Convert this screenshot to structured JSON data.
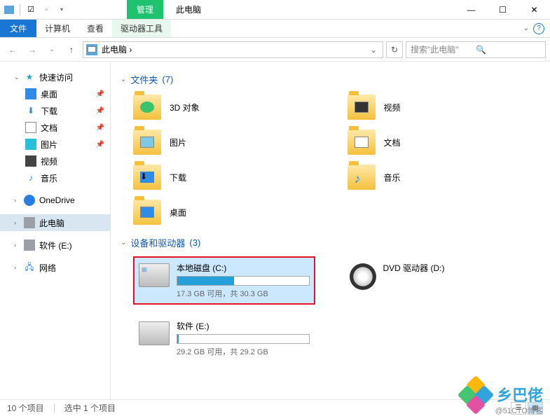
{
  "titlebar": {
    "context_tab": "管理",
    "title": "此电脑"
  },
  "ribbon": {
    "file": "文件",
    "tabs": [
      "计算机",
      "查看"
    ],
    "context_tab": "驱动器工具"
  },
  "address": {
    "path": "此电脑 ›",
    "search_placeholder": "搜索\"此电脑\""
  },
  "sidebar": {
    "quick_access": "快速访问",
    "items": [
      {
        "label": "桌面",
        "pinned": true
      },
      {
        "label": "下载",
        "pinned": true
      },
      {
        "label": "文档",
        "pinned": true
      },
      {
        "label": "图片",
        "pinned": true
      },
      {
        "label": "视频",
        "pinned": false
      },
      {
        "label": "音乐",
        "pinned": false
      }
    ],
    "onedrive": "OneDrive",
    "this_pc": "此电脑",
    "software": "软件 (E:)",
    "network": "网络"
  },
  "groups": {
    "folders": {
      "label": "文件夹",
      "count": "(7)"
    },
    "drives": {
      "label": "设备和驱动器",
      "count": "(3)"
    }
  },
  "folders": [
    {
      "name": "3D 对象"
    },
    {
      "name": "视频"
    },
    {
      "name": "图片"
    },
    {
      "name": "文档"
    },
    {
      "name": "下载"
    },
    {
      "name": "音乐"
    },
    {
      "name": "桌面"
    }
  ],
  "drives": [
    {
      "name": "本地磁盘 (C:)",
      "stats": "17.3 GB 可用，共 30.3 GB",
      "fill_pct": 43,
      "selected": true,
      "type": "hdd"
    },
    {
      "name": "DVD 驱动器 (D:)",
      "stats": "",
      "fill_pct": null,
      "selected": false,
      "type": "dvd"
    },
    {
      "name": "软件 (E:)",
      "stats": "29.2 GB 可用，共 29.2 GB",
      "fill_pct": 1,
      "selected": false,
      "type": "hdd"
    }
  ],
  "statusbar": {
    "count": "10 个项目",
    "selected": "选中 1 个项目"
  },
  "watermark": {
    "text": "乡巴佬",
    "sub": "@51CTO博客"
  }
}
